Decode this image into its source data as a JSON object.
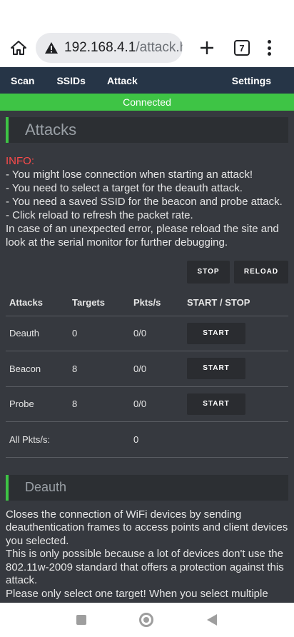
{
  "browser": {
    "url_host": "192.168.4.1",
    "url_path": "/attack.ht",
    "tab_count": "7"
  },
  "nav": {
    "items": [
      "Scan",
      "SSIDs",
      "Attack",
      "Settings"
    ]
  },
  "status": "Connected",
  "attacks_section": {
    "title": "Attacks",
    "info_label": "INFO:",
    "info_lines": [
      "- You might lose connection when starting an attack!",
      "- You need to select a target for the deauth attack.",
      "- You need a saved SSID for the beacon and probe attack.",
      "- Click reload to refresh the packet rate.",
      "In case of an unexpected error, please reload the site and look at the serial monitor for further debugging."
    ],
    "stop_label": "STOP",
    "reload_label": "RELOAD"
  },
  "table": {
    "headers": [
      "Attacks",
      "Targets",
      "Pkts/s",
      "START / STOP"
    ],
    "rows": [
      {
        "name": "Deauth",
        "targets": "0",
        "pkts": "0/0",
        "action": "START"
      },
      {
        "name": "Beacon",
        "targets": "8",
        "pkts": "0/0",
        "action": "START"
      },
      {
        "name": "Probe",
        "targets": "8",
        "pkts": "0/0",
        "action": "START"
      }
    ],
    "total_label": "All Pkts/s:",
    "total_value": "0"
  },
  "deauth_section": {
    "title": "Deauth",
    "description": "Closes the connection of WiFi devices by sending deauthentication frames to access points and client devices you selected.",
    "description2": "This is only possible because a lot of devices don't use the 802.11w-2009 standard that offers a protection against this attack.",
    "description3": "Please only select one target! When you select multiple"
  },
  "colors": {
    "accent": "#3ec445",
    "background": "#36393f",
    "navbar": "#263547",
    "info_label": "#ff4b4b"
  }
}
